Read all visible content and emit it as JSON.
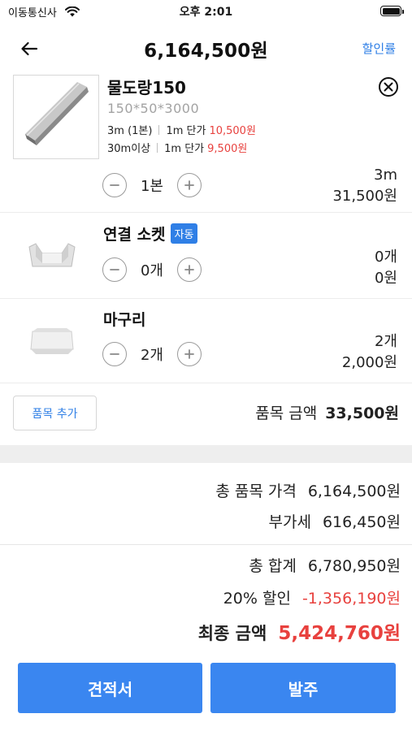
{
  "status_bar": {
    "carrier": "이동통신사",
    "time": "오후 2:01"
  },
  "nav": {
    "title": "6,164,500원",
    "action_label": "할인률"
  },
  "main_item": {
    "name": "물도랑150",
    "spec": "150*50*3000",
    "price_tiers": [
      {
        "qty_label": "3m (1본)",
        "unit_label": "1m 단가",
        "price": "10,500원"
      },
      {
        "qty_label": "30m이상",
        "unit_label": "1m 단가",
        "price": "9,500원"
      }
    ],
    "quantity": "1본",
    "length": "3m",
    "amount": "31,500원"
  },
  "sub_items": [
    {
      "name": "연결 소켓",
      "badge": "자동",
      "quantity": "0개",
      "count": "0개",
      "amount": "0원"
    },
    {
      "name": "마구리",
      "quantity": "2개",
      "count": "2개",
      "amount": "2,000원"
    }
  ],
  "item_summary": {
    "add_button": "품목 추가",
    "label": "품목 금액",
    "amount": "33,500원"
  },
  "totals": {
    "total_items_label": "총 품목 가격",
    "total_items_value": "6,164,500원",
    "vat_label": "부가세",
    "vat_value": "616,450원",
    "sum_label": "총 합계",
    "sum_value": "6,780,950원",
    "discount_label": "20% 할인",
    "discount_value": "-1,356,190원",
    "final_label": "최종 금액",
    "final_value": "5,424,760원"
  },
  "buttons": {
    "estimate": "견적서",
    "order": "발주"
  },
  "colors": {
    "accent": "#2f7fe6",
    "button": "#3a86f0",
    "negative": "#e8413e"
  },
  "icons": [
    "wifi-icon",
    "battery-icon",
    "back-arrow-icon",
    "remove-circle-icon",
    "minus-circle-icon",
    "plus-circle-icon"
  ]
}
